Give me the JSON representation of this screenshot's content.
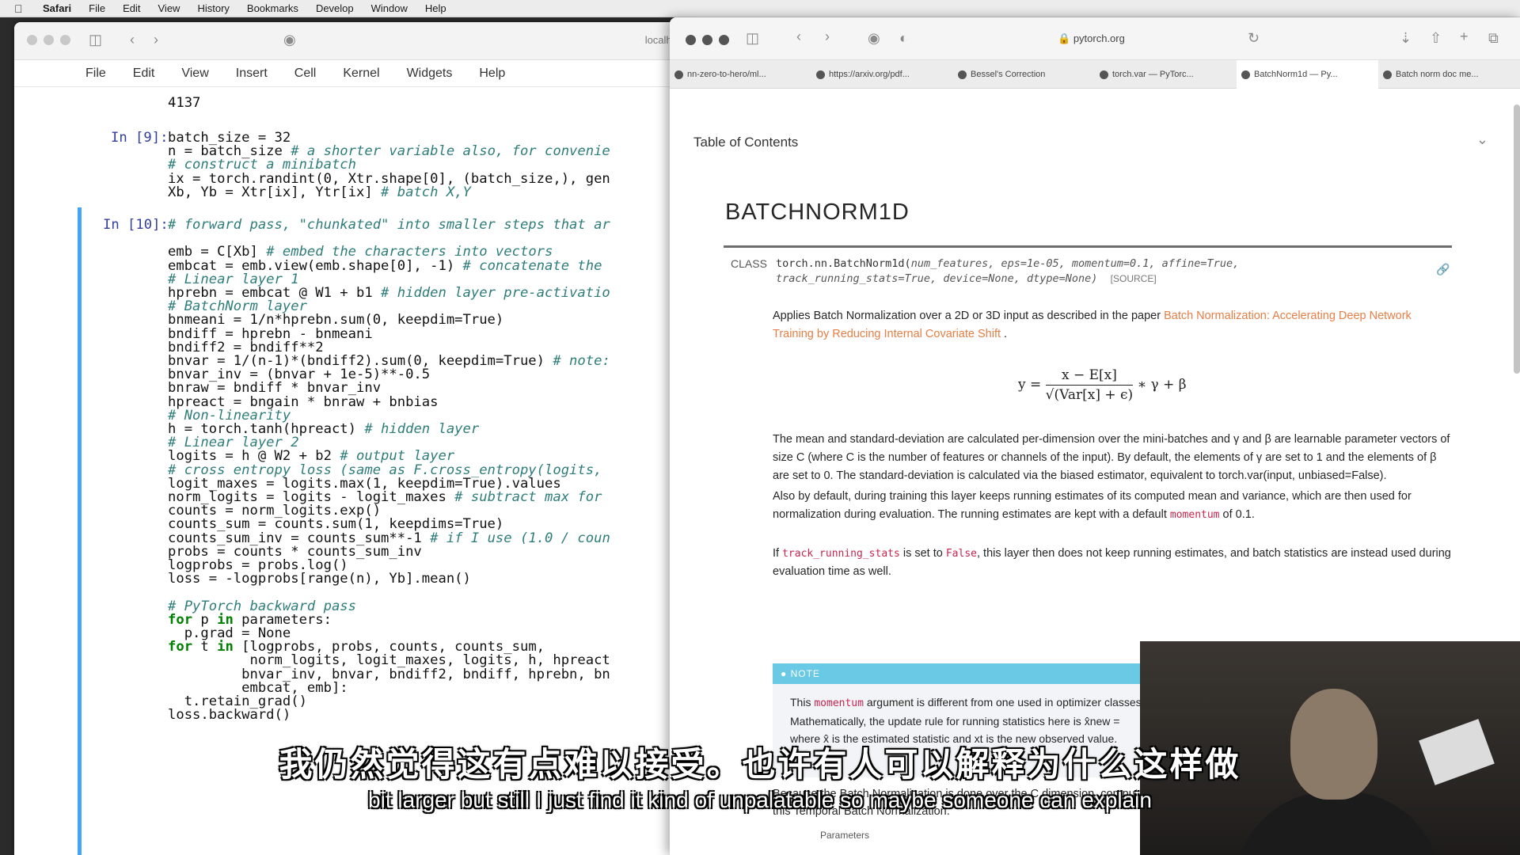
{
  "menubar": {
    "app": "Safari",
    "items": [
      "File",
      "Edit",
      "View",
      "History",
      "Bookmarks",
      "Develop",
      "Window",
      "Help"
    ]
  },
  "jupyter": {
    "address": "localhost",
    "menu": [
      "File",
      "Edit",
      "View",
      "Insert",
      "Cell",
      "Kernel",
      "Widgets",
      "Help"
    ],
    "output_top": "4137",
    "cell9_prompt": "In [9]:",
    "cell9": [
      {
        "t": "batch_size = 32",
        "c": ""
      },
      {
        "t": "n = batch_size ",
        "c": "# a shorter variable also, for convenie"
      },
      {
        "t": "",
        "c": "# construct a minibatch"
      },
      {
        "t": "ix = torch.randint(0, Xtr.shape[0], (batch_size,), gen",
        "c": ""
      },
      {
        "t": "Xb, Yb = Xtr[ix], Ytr[ix] ",
        "c": "# batch X,Y"
      }
    ],
    "cell10_prompt": "In [10]:",
    "cell10": [
      {
        "t": "",
        "c": "# forward pass, \"chunkated\" into smaller steps that ar"
      },
      {
        "t": "",
        "c": ""
      },
      {
        "t": "emb = C[Xb] ",
        "c": "# embed the characters into vectors"
      },
      {
        "t": "embcat = emb.view(emb.shape[0], -1) ",
        "c": "# concatenate the"
      },
      {
        "t": "",
        "c": "# Linear layer 1"
      },
      {
        "t": "hprebn = embcat @ W1 + b1 ",
        "c": "# hidden layer pre-activatio"
      },
      {
        "t": "",
        "c": "# BatchNorm layer"
      },
      {
        "t": "bnmeani = 1/n*hprebn.sum(0, keepdim=True)",
        "c": ""
      },
      {
        "t": "bndiff = hprebn - bnmeani",
        "c": ""
      },
      {
        "t": "bndiff2 = bndiff**2",
        "c": ""
      },
      {
        "t": "bnvar = 1/(n-1)*(bndiff2).sum(0, keepdim=True) ",
        "c": "# note:"
      },
      {
        "t": "bnvar_inv = (bnvar + 1e-5)**-0.5",
        "c": ""
      },
      {
        "t": "bnraw = bndiff * bnvar_inv",
        "c": ""
      },
      {
        "t": "hpreact = bngain * bnraw + bnbias",
        "c": ""
      },
      {
        "t": "",
        "c": "# Non-linearity"
      },
      {
        "t": "h = torch.tanh(hpreact) ",
        "c": "# hidden layer"
      },
      {
        "t": "",
        "c": "# Linear layer 2"
      },
      {
        "t": "logits = h @ W2 + b2 ",
        "c": "# output layer"
      },
      {
        "t": "",
        "c": "# cross entropy loss (same as F.cross_entropy(logits,"
      },
      {
        "t": "logit_maxes = logits.max(1, keepdim=True).values",
        "c": ""
      },
      {
        "t": "norm_logits = logits - logit_maxes ",
        "c": "# subtract max for"
      },
      {
        "t": "counts = norm_logits.exp()",
        "c": ""
      },
      {
        "t": "counts_sum = counts.sum(1, keepdims=True)",
        "c": ""
      },
      {
        "t": "counts_sum_inv = counts_sum**-1 ",
        "c": "# if I use (1.0 / coun"
      },
      {
        "t": "probs = counts * counts_sum_inv",
        "c": ""
      },
      {
        "t": "logprobs = probs.log()",
        "c": ""
      },
      {
        "t": "loss = -logprobs[range(n), Yb].mean()",
        "c": ""
      },
      {
        "t": "",
        "c": ""
      },
      {
        "t": "",
        "c": "# PyTorch backward pass"
      },
      {
        "t": "for p in parameters:",
        "c": ""
      },
      {
        "t": "  p.grad = None",
        "c": ""
      },
      {
        "t": "for t in [logprobs, probs, counts, counts_sum,",
        "c": ""
      },
      {
        "t": "          norm_logits, logit_maxes, logits, h, hpreact",
        "c": ""
      },
      {
        "t": "         bnvar_inv, bnvar, bndiff2, bndiff, hprebn, bn",
        "c": ""
      },
      {
        "t": "         embcat, emb]:",
        "c": ""
      },
      {
        "t": "  t.retain_grad()",
        "c": ""
      },
      {
        "t": "loss.backward()",
        "c": ""
      }
    ]
  },
  "safari": {
    "url": "pytorch.org",
    "tabs": [
      "nn-zero-to-hero/ml...",
      "https://arxiv.org/pdf...",
      "Bessel's Correction",
      "torch.var — PyTorc...",
      "BatchNorm1d — Py...",
      "Batch norm doc me..."
    ],
    "active_tab": 4,
    "toc": "Table of Contents",
    "title": "BATCHNORM1D",
    "class_label": "CLASS",
    "signature_fn": "torch.nn.BatchNorm1d(",
    "signature_args1": "num_features, eps=1e-05, momentum=0.1, affine=True,",
    "signature_args2": "track_running_stats=True, device=None, dtype=None)",
    "source": "[SOURCE]",
    "p1_a": "Applies Batch Normalization over a 2D or 3D input as described in the paper ",
    "p1_link": "Batch Normalization: Accelerating Deep Network Training by Reducing Internal Covariate Shift",
    "p1_b": " .",
    "formula_y": "y = ",
    "formula_num": "x − E[x]",
    "formula_den": "√(Var[x] + ϵ)",
    "formula_tail": " ∗ γ + β",
    "p2": "The mean and standard-deviation are calculated per-dimension over the mini-batches and γ and β are learnable parameter vectors of size C (where C is the number of features or channels of the input). By default, the elements of γ are set to 1 and the elements of β are set to 0. The standard-deviation is calculated via the biased estimator, equivalent to torch.var(input, unbiased=False).",
    "p3_a": "Also by default, during training this layer keeps running estimates of its computed mean and variance, which are then used for normalization during evaluation. The running estimates are kept with a default ",
    "p3_code": "momentum",
    "p3_b": " of 0.1.",
    "p4_a": "If ",
    "p4_code1": "track_running_stats",
    "p4_b": " is set to ",
    "p4_code2": "False",
    "p4_c": ", this layer then does not keep running estimates, and batch statistics are instead used during evaluation time as well.",
    "note_label": "● NOTE",
    "note_a": "This ",
    "note_code": "momentum",
    "note_b": " argument is different from one used in optimizer classes and the conventional notion of momentum. Mathematically, the update rule for running statistics here is x̂new = ",
    "note_c": "where x̂ is the estimated statistic and xt is the new observed value.",
    "p5": "Because the Batch Normalization is done over the C dimension, comput",
    "p5b": "this Temporal Batch Normalization.",
    "params": "Parameters"
  },
  "subtitles": {
    "zh": "我仍然觉得这有点难以接受。也许有人可以解释为什么这样做",
    "en": "bit larger but still I just find it kind of unpalatable so maybe someone can explain"
  }
}
